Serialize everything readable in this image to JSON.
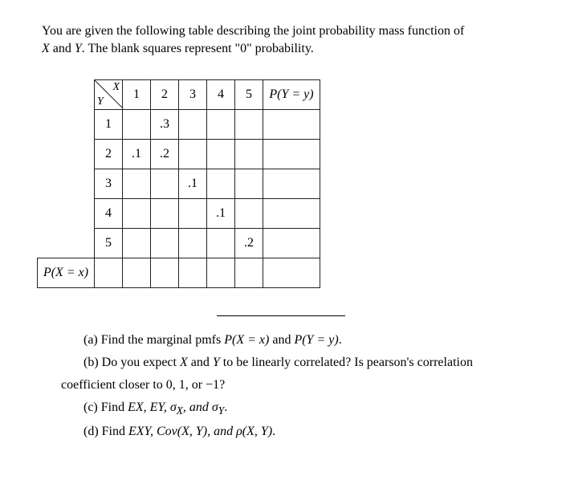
{
  "intro_line1": "You are given the following table describing the joint probability mass function of",
  "intro_line2_a": " and ",
  "intro_line2_b": ". The blank squares represent \"0\" probability.",
  "var_X": "X",
  "var_Y": "Y",
  "col_headers": [
    "1",
    "2",
    "3",
    "4",
    "5"
  ],
  "row_headers": [
    "1",
    "2",
    "3",
    "4",
    "5"
  ],
  "px_label": "P(X = x)",
  "py_label": "P(Y = y)",
  "cells": {
    "r1": [
      "",
      ".3",
      "",
      "",
      ""
    ],
    "r2": [
      ".1",
      ".2",
      "",
      "",
      ""
    ],
    "r3": [
      "",
      "",
      ".1",
      "",
      ""
    ],
    "r4": [
      "",
      "",
      "",
      ".1",
      ""
    ],
    "r5": [
      "",
      "",
      "",
      "",
      ".2"
    ]
  },
  "q_a_pre": "(a) Find the marginal pmfs ",
  "q_a_mid": " and ",
  "q_a_post": ".",
  "q_b_pre": "(b) Do you expect ",
  "q_b_mid": " and ",
  "q_b_mid2": " to be linearly correlated?  Is pearson's correlation",
  "q_b_line2": "coefficient closer to 0, 1, or −1?",
  "q_c_pre": "(c) Find ",
  "q_c_items": "EX, EY, σX, and σY",
  "q_c_post": ".",
  "q_d_pre": "(d) Find ",
  "q_d_items": "EXY, Cov(X, Y), and ρ(X, Y)",
  "q_d_post": ".",
  "pmf_px": "P(X = x)",
  "pmf_py": "P(Y = y)",
  "chart_data": {
    "type": "table",
    "title": "Joint probability mass function of X and Y",
    "x_values": [
      1,
      2,
      3,
      4,
      5
    ],
    "y_values": [
      1,
      2,
      3,
      4,
      5
    ],
    "joint_pmf": [
      {
        "x": 1,
        "y": 2,
        "p": 0.1
      },
      {
        "x": 2,
        "y": 1,
        "p": 0.3
      },
      {
        "x": 2,
        "y": 2,
        "p": 0.2
      },
      {
        "x": 3,
        "y": 3,
        "p": 0.1
      },
      {
        "x": 4,
        "y": 4,
        "p": 0.1
      },
      {
        "x": 5,
        "y": 5,
        "p": 0.2
      }
    ],
    "note": "blank cells are 0 probability"
  }
}
